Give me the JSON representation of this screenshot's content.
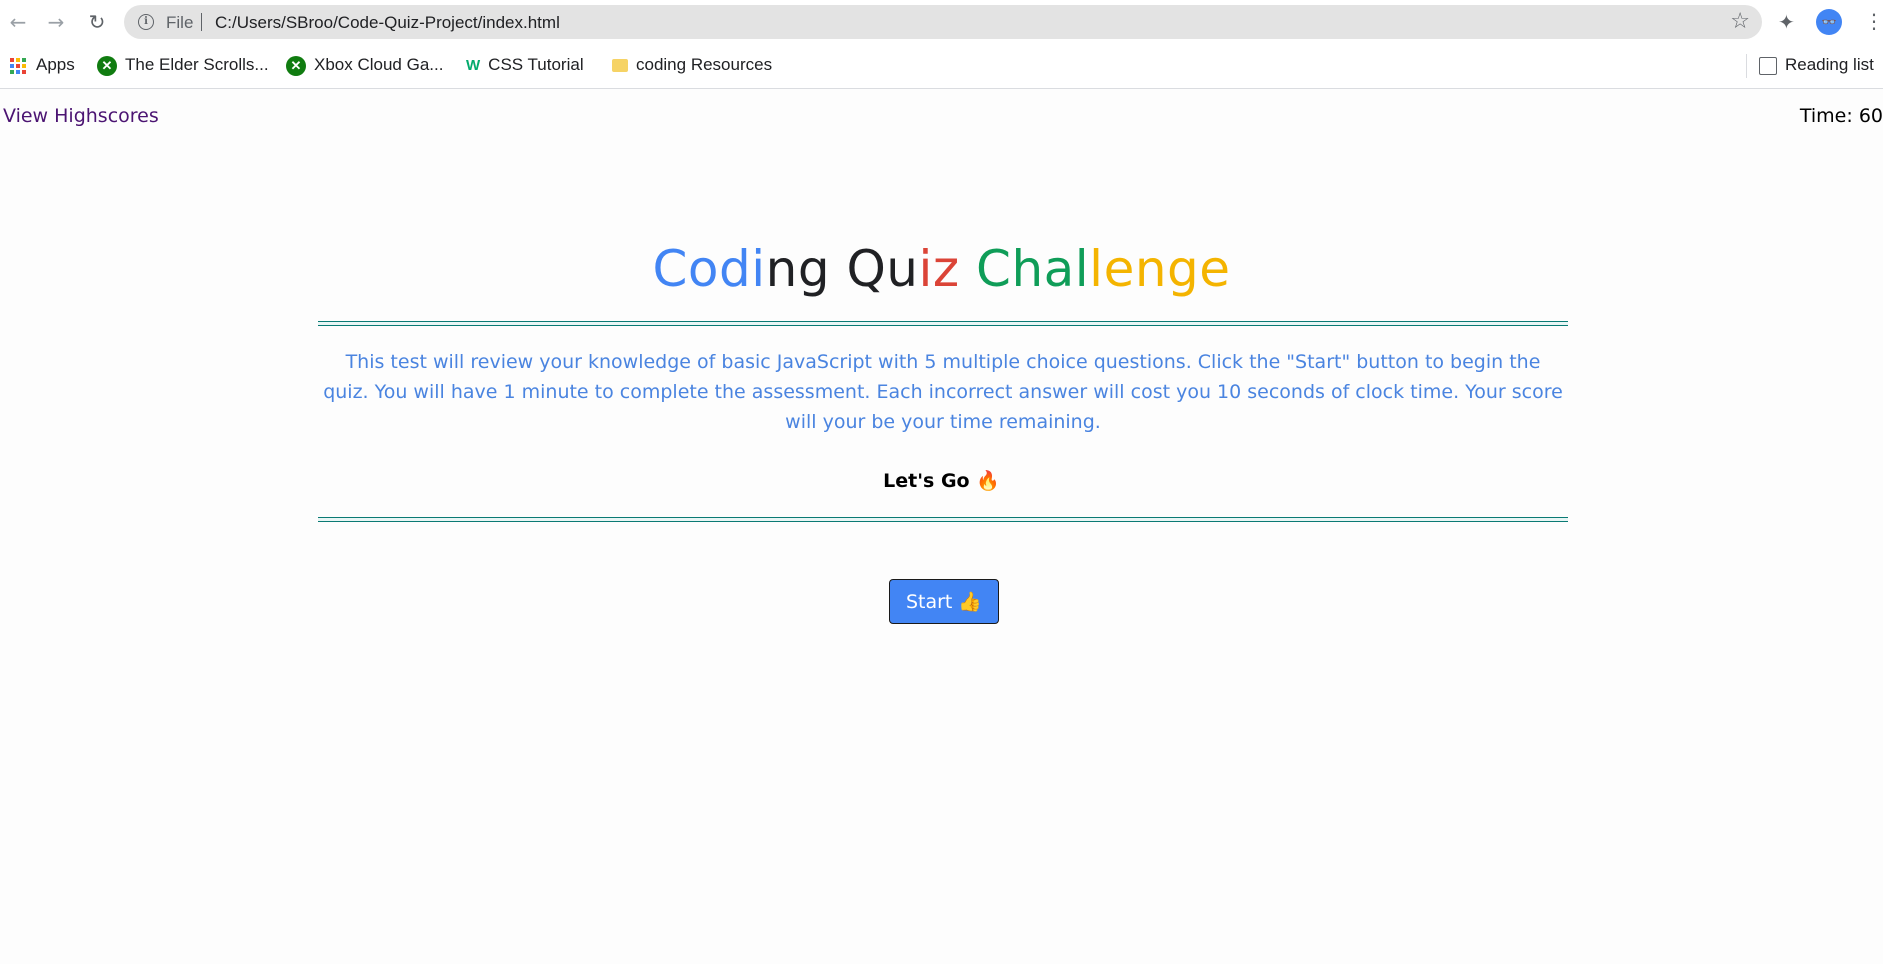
{
  "browser": {
    "omnibox": {
      "scheme_label": "File",
      "url": "C:/Users/SBroo/Code-Quiz-Project/index.html"
    },
    "avatar_label": "👓",
    "bookmarks": [
      {
        "label": "Apps",
        "icon": "apps-grid-icon"
      },
      {
        "label": "The Elder Scrolls...",
        "icon": "xbox-icon"
      },
      {
        "label": "Xbox Cloud Ga...",
        "icon": "xbox-icon"
      },
      {
        "label": "CSS Tutorial",
        "icon": "w3schools-icon"
      },
      {
        "label": "coding Resources",
        "icon": "folder-icon"
      }
    ],
    "reading_list": "Reading list"
  },
  "page": {
    "view_highscores": "View Highscores",
    "timer": "Time: 60",
    "title_parts": [
      {
        "text": "Cod",
        "color": "#4285f4"
      },
      {
        "text": "i",
        "color": "#4285f4"
      },
      {
        "text": "ng ",
        "color": "#202124"
      },
      {
        "text": "Qu",
        "color": "#202124"
      },
      {
        "text": "iz ",
        "color": "#db4437"
      },
      {
        "text": "Chal",
        "color": "#0f9d58"
      },
      {
        "text": "lenge",
        "color": "#f4b400"
      }
    ],
    "description": "This test will review your knowledge of basic JavaScript with 5 multiple choice questions. Click the \"Start\" button to begin the quiz. You will have 1 minute to complete the assessment. Each incorrect answer will cost you 10 seconds of clock time. Your score will your be your time remaining.",
    "lets_go": "Let's Go 🔥",
    "start_button": "Start 👍"
  },
  "colors": {
    "accent_blue": "#4285f4",
    "description_blue": "#4a84e0",
    "link_purple": "#4b1472",
    "rule_teal": "#0a7a74"
  }
}
